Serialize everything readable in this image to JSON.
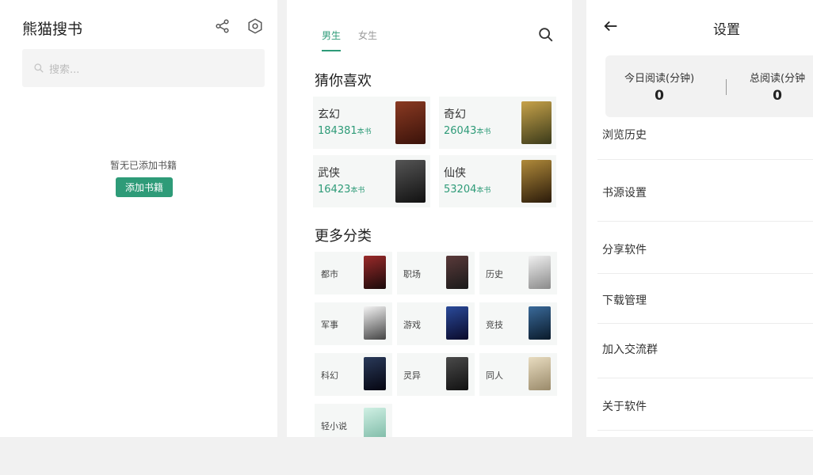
{
  "panel1": {
    "app_title": "熊猫搜书",
    "search_placeholder": "搜索...",
    "empty_text": "暂无已添加书籍",
    "add_button": "添加书籍",
    "icons": [
      "share-icon",
      "gear-icon",
      "search-icon"
    ]
  },
  "panel2": {
    "tabs": [
      {
        "label": "男生",
        "active": true
      },
      {
        "label": "女生",
        "active": false
      }
    ],
    "guess_title": "猜你喜欢",
    "favorites": [
      {
        "name": "玄幻",
        "count": "184381",
        "unit": "本书",
        "cover_color": "#6b2a1a"
      },
      {
        "name": "奇幻",
        "count": "26043",
        "unit": "本书",
        "cover_color": "#8a6d2a"
      },
      {
        "name": "武侠",
        "count": "16423",
        "unit": "本书",
        "cover_color": "#3b3b3b"
      },
      {
        "name": "仙侠",
        "count": "53204",
        "unit": "本书",
        "cover_color": "#5a4a2a"
      }
    ],
    "more_title": "更多分类",
    "categories": [
      {
        "name": "都市",
        "cover_color": "#4a1a1a"
      },
      {
        "name": "职场",
        "cover_color": "#3a2a2a"
      },
      {
        "name": "历史",
        "cover_color": "#d8d8d8"
      },
      {
        "name": "军事",
        "cover_color": "#e8e8e8"
      },
      {
        "name": "游戏",
        "cover_color": "#1a2a5a"
      },
      {
        "name": "竞技",
        "cover_color": "#1a3a5a"
      },
      {
        "name": "科幻",
        "cover_color": "#1a1a2a"
      },
      {
        "name": "灵异",
        "cover_color": "#2a2a2a"
      },
      {
        "name": "同人",
        "cover_color": "#c9b89a"
      },
      {
        "name": "轻小说",
        "cover_color": "#a8d8c8"
      }
    ]
  },
  "panel3": {
    "title": "设置",
    "stats": [
      {
        "label": "今日阅读(分钟)",
        "value": "0"
      },
      {
        "label": "总阅读(分钟",
        "value": "0"
      }
    ],
    "menu": [
      {
        "label": "浏览历史"
      },
      {
        "label": "书源设置"
      },
      {
        "label": "分享软件"
      },
      {
        "label": "下载管理"
      },
      {
        "label": "加入交流群"
      },
      {
        "label": "关于软件"
      }
    ]
  },
  "accent_color": "#2e9b78"
}
